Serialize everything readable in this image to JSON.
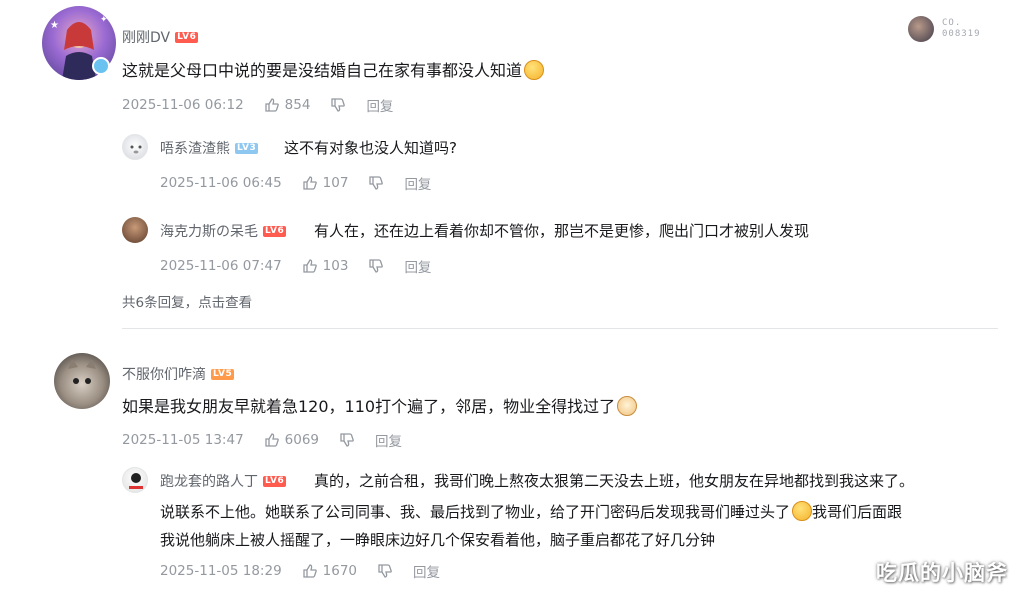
{
  "top_right": {
    "line1": "CO.",
    "line2": "008319"
  },
  "comments": [
    {
      "user": "刚刚DV",
      "level": "LV6",
      "text": "这就是父母口中说的要是没结婚自己在家有事都没人知道",
      "time": "2025-11-06 06:12",
      "likes": "854",
      "reply_label": "回复",
      "replies": [
        {
          "user": "唔系渣渣熊",
          "level": "LV3",
          "text": "这不有对象也没人知道吗?",
          "time": "2025-11-06 06:45",
          "likes": "107",
          "reply_label": "回复"
        },
        {
          "user": "海克力斯の呆毛",
          "level": "LV6",
          "text": "有人在，还在边上看着你却不管你，那岂不是更惨，爬出门口才被别人发现",
          "time": "2025-11-06 07:47",
          "likes": "103",
          "reply_label": "回复"
        }
      ],
      "more_replies": "共6条回复，点击查看"
    },
    {
      "user": "不服你们咋滴",
      "level": "LV5",
      "text": "如果是我女朋友早就着急120，110打个遍了，邻居，物业全得找过了",
      "time": "2025-11-05 13:47",
      "likes": "6069",
      "reply_label": "回复",
      "replies": [
        {
          "user": "跑龙套的路人丁",
          "level": "LV6",
          "text_line1": "真的，之前合租，我哥们晚上熬夜太狠第二天没去上班，他女朋友在异地都找到我这来了。",
          "text_line2a": "说联系不上他。她联系了公司同事、我、最后找到了物业，给了开门密码后发现我哥们睡过头了",
          "text_line2b": "我哥们后面跟",
          "text_line3": "我说他躺床上被人摇醒了，一睁眼床边好几个保安看着他，脑子重启都花了好几分钟",
          "time": "2025-11-05 18:29",
          "likes": "1670",
          "reply_label": "回复"
        }
      ]
    }
  ],
  "watermark": "吃瓜的小脑斧"
}
